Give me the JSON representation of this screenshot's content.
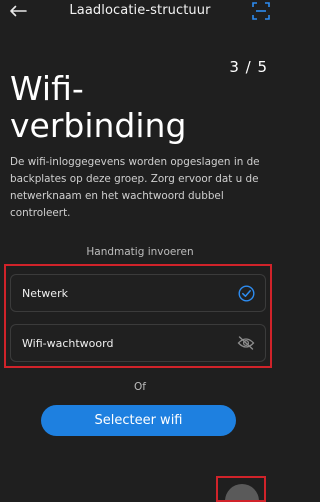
{
  "header": {
    "title": "Laadlocatie-structuur",
    "back_icon": "arrow-left-icon",
    "scan_icon": "scan-frame-icon"
  },
  "progress": {
    "step_text": "3 / 5"
  },
  "main": {
    "title": "Wifi-verbinding",
    "description": "De wifi-inloggegevens worden opgeslagen in de backplates op deze groep. Zorg ervoor dat u de netwerknaam en het wachtwoord dubbel controleert.",
    "manual_entry_label": "Handmatig invoeren",
    "fields": [
      {
        "label": "Netwerk",
        "icon": "check-circle-icon"
      },
      {
        "label": "Wifi-wachtwoord",
        "icon": "eye-off-icon"
      }
    ],
    "or_label": "Of",
    "select_wifi_label": "Selecteer wifi"
  },
  "colors": {
    "background": "#1f1f1f",
    "accent": "#1e80e0",
    "highlight": "#d0232a"
  }
}
